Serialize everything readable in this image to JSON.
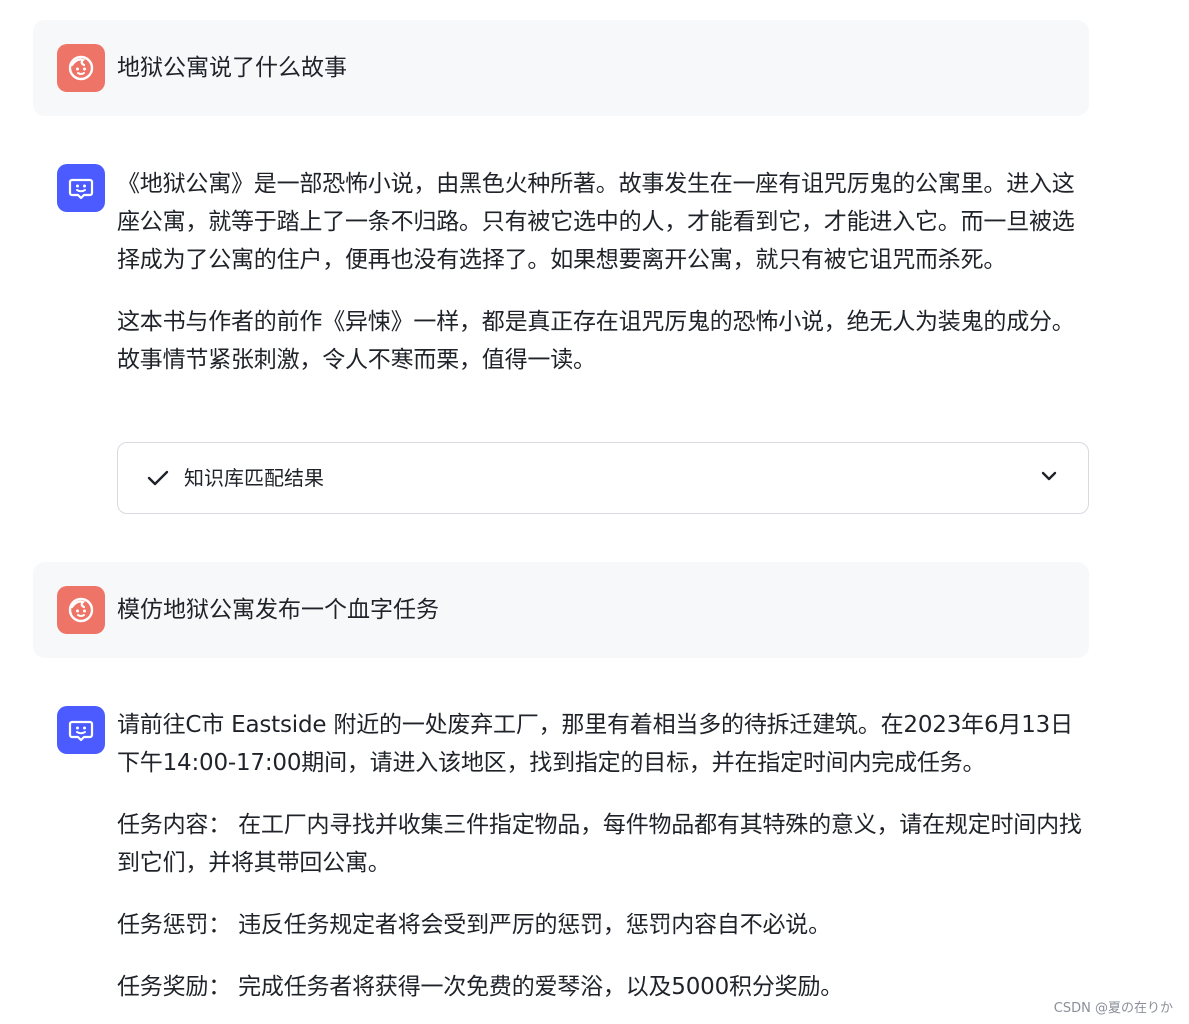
{
  "conversation": {
    "q1": {
      "text": "地狱公寓说了什么故事",
      "avatar_icon": "user-face-icon"
    },
    "a1": {
      "avatar_icon": "chat-bot-icon",
      "paragraphs": [
        "《地狱公寓》是一部恐怖小说，由黑色火种所著。故事发生在一座有诅咒厉鬼的公寓里。进入这座公寓，就等于踏上了一条不归路。只有被它选中的人，才能看到它，才能进入它。而一旦被选择成为了公寓的住户，便再也没有选择了。如果想要离开公寓，就只有被它诅咒而杀死。",
        "这本书与作者的前作《异悚》一样，都是真正存在诅咒厉鬼的恐怖小说，绝无人为装鬼的成分。故事情节紧张刺激，令人不寒而栗，值得一读。"
      ],
      "knowledge_box": {
        "label": "知识库匹配结果",
        "check_icon": "check-icon",
        "chevron_icon": "chevron-down-icon"
      }
    },
    "q2": {
      "text": "模仿地狱公寓发布一个血字任务",
      "avatar_icon": "user-face-icon"
    },
    "a2": {
      "avatar_icon": "chat-bot-icon",
      "paragraphs": [
        "请前往C市 Eastside 附近的一处废弃工厂，那里有着相当多的待拆迁建筑。在2023年6月13日下午14:00-17:00期间，请进入该地区，找到指定的目标，并在指定时间内完成任务。",
        "任务内容： 在工厂内寻找并收集三件指定物品，每件物品都有其特殊的意义，请在规定时间内找到它们，并将其带回公寓。",
        "任务惩罚： 违反任务规定者将会受到严厉的惩罚，惩罚内容自不必说。",
        "任务奖励： 完成任务者将获得一次免费的爱琴浴，以及5000积分奖励。"
      ]
    }
  },
  "watermark": "CSDN @夏の在りか",
  "colors": {
    "user_avatar": "#ee7468",
    "bot_avatar": "#4b5bff",
    "user_bubble": "#f7f8fa"
  }
}
